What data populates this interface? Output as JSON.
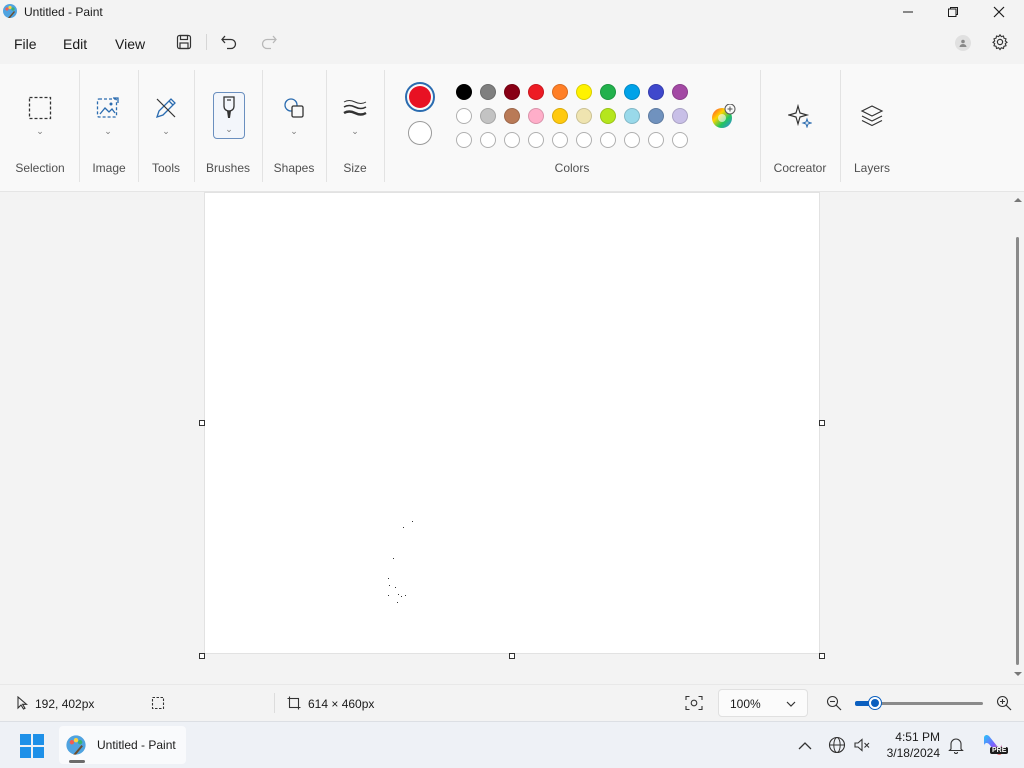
{
  "window": {
    "title": "Untitled - Paint"
  },
  "menu": {
    "file": "File",
    "edit": "Edit",
    "view": "View"
  },
  "ribbon": {
    "selection": "Selection",
    "image": "Image",
    "tools": "Tools",
    "brushes": "Brushes",
    "shapes": "Shapes",
    "size": "Size",
    "colors": "Colors",
    "cocreator": "Cocreator",
    "layers": "Layers"
  },
  "colors": {
    "primary": "#e81123",
    "secondary": "#ffffff",
    "palette_row1": [
      "#000000",
      "#7f7f7f",
      "#880015",
      "#ed1c24",
      "#ff7f27",
      "#fff200",
      "#22b14c",
      "#00a2e8",
      "#3f48cc",
      "#a349a4"
    ],
    "palette_row2": [
      "#ffffff",
      "#c3c3c3",
      "#b97a57",
      "#ffaec9",
      "#ffc90e",
      "#efe4b0",
      "#b5e61d",
      "#99d9ea",
      "#7092be",
      "#c8bfe7"
    ],
    "palette_row3_count": 10,
    "accent": "#0a5fbf"
  },
  "status": {
    "cursor_position": "192, 402px",
    "canvas_size": "614 × 460px",
    "zoom": "100%",
    "zoom_slider_fraction": 0.16
  },
  "taskbar": {
    "app_label": "Untitled - Paint",
    "time": "4:51 PM",
    "date": "3/18/2024"
  }
}
